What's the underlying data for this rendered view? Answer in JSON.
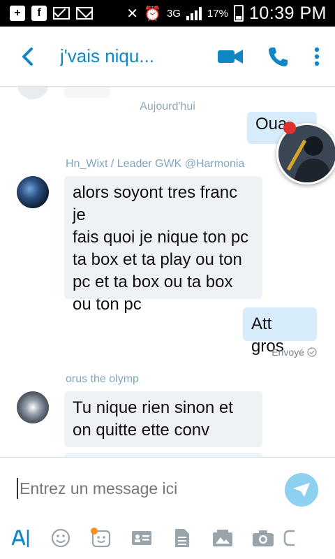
{
  "status_bar": {
    "signal_label": "3G",
    "battery": "17%",
    "time": "10:39 PM"
  },
  "header": {
    "title": "j'vais niqu..."
  },
  "chat": {
    "date_separator": "Aujourd'hui",
    "partial_outgoing": "Oua",
    "messages": [
      {
        "sender": "Hn_Wixt / Leader GWK @Harmonia",
        "lines": [
          "alors soyont tres franc je",
          "fais quoi je nique ton pc",
          "ta box et ta play ou ton",
          "pc et ta box ou ta box",
          "ou ton pc"
        ]
      },
      {
        "outgoing": true,
        "text": "Att gros",
        "status": "Envoyé"
      },
      {
        "sender": "orus the olymp",
        "lines": [
          "Tu nique rien sinon et",
          "on quitte ette conv"
        ]
      }
    ]
  },
  "composer": {
    "placeholder": "Entrez un message ici"
  },
  "colors": {
    "accent": "#0f87c7",
    "incoming_bubble": "#eef1f5",
    "outgoing_bubble": "#d7ecfa",
    "send_button": "#8ed0ef"
  }
}
